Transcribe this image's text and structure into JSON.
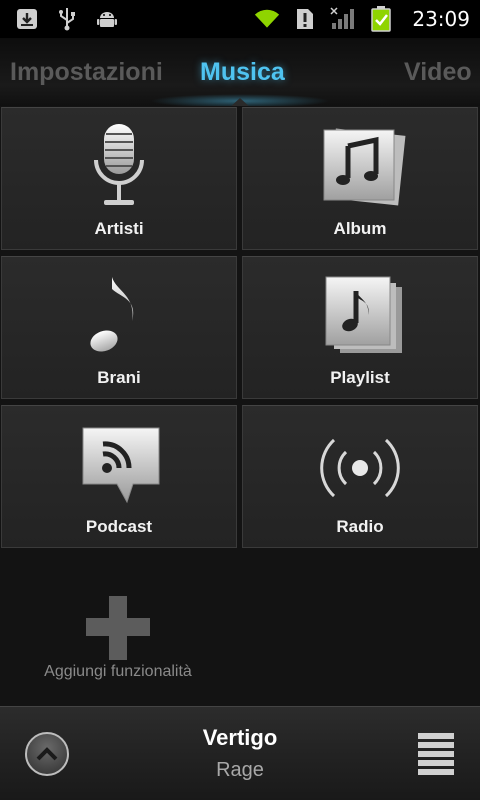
{
  "status_bar": {
    "time": "23:09",
    "icons": [
      "download-icon",
      "usb-icon",
      "android-icon",
      "wifi-icon",
      "alert-icon",
      "signal-icon",
      "battery-charging-icon"
    ]
  },
  "tabs": {
    "left": "Impostazioni",
    "center": "Musica",
    "right": "Video"
  },
  "tiles": [
    {
      "label": "Artisti",
      "icon": "microphone-icon"
    },
    {
      "label": "Album",
      "icon": "album-icon"
    },
    {
      "label": "Brani",
      "icon": "music-note-icon"
    },
    {
      "label": "Playlist",
      "icon": "playlist-icon"
    },
    {
      "label": "Podcast",
      "icon": "podcast-icon"
    },
    {
      "label": "Radio",
      "icon": "radio-icon"
    }
  ],
  "add_feature": {
    "label": "Aggiungi funzionalità",
    "icon": "plus-icon"
  },
  "now_playing": {
    "title": "Vertigo",
    "artist": "Rage"
  },
  "colors": {
    "accent": "#4fc3f0",
    "battery": "#8fd400",
    "wifi": "#8fd400"
  }
}
